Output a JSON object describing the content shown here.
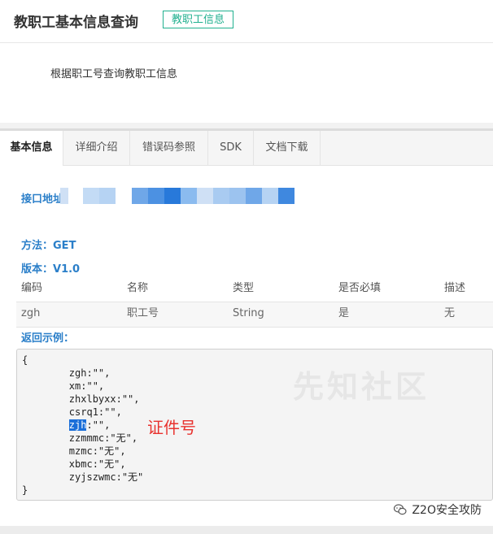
{
  "header": {
    "title": "教职工基本信息查询",
    "badge": "教职工信息"
  },
  "description": "根据职工号查询教职工信息",
  "tabs": [
    {
      "label": "基本信息",
      "active": true
    },
    {
      "label": "详细介绍",
      "active": false
    },
    {
      "label": "错误码参照",
      "active": false
    },
    {
      "label": "SDK",
      "active": false
    },
    {
      "label": "文档下载",
      "active": false
    }
  ],
  "api": {
    "address_label": "接口地址",
    "method_label": "方法：",
    "method_value": "GET",
    "version_label": "版本：",
    "version_value": "V1.0"
  },
  "params": {
    "columns": [
      "编码",
      "名称",
      "类型",
      "是否必填",
      "描述"
    ],
    "rows": [
      [
        "zgh",
        "职工号",
        "String",
        "是",
        "无"
      ]
    ]
  },
  "example": {
    "label": "返回示例：",
    "lines": [
      "{",
      "        zgh:\"\",",
      "        xm:\"\",",
      "        zhxlbyxx:\"\",",
      "        csrq1:\"\",",
      "        zjh:\"\",",
      "        zzmmmc:\"无\",",
      "        mzmc:\"无\",",
      "        xbmc:\"无\",",
      "        zyjszwmc:\"无\"",
      "}"
    ],
    "highlight_line_prefix": "        ",
    "highlight_text": "zjh",
    "highlight_rest": ":\"\","
  },
  "annotation": "证件号",
  "watermark": "先知社区",
  "brand": "Z2O安全攻防",
  "colors": {
    "accent_green": "#21b08f",
    "link_blue": "#2b7fc9",
    "highlight_blue": "#1b6fd9",
    "annotation_red": "#e8322e"
  }
}
